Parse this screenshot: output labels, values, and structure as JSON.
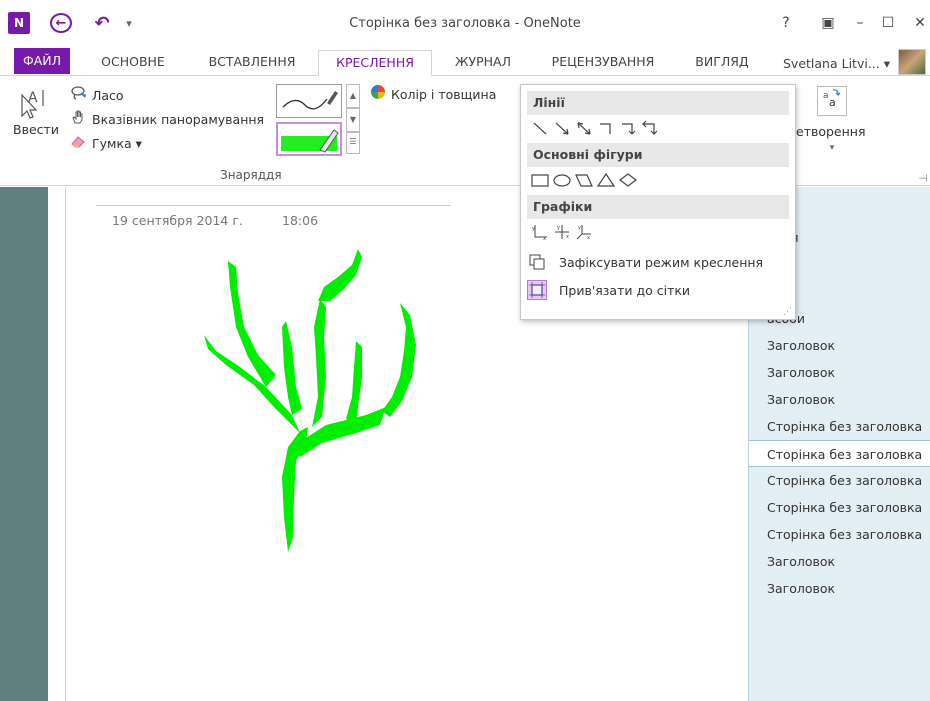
{
  "app": {
    "title": "Сторінка без заголовка - OneNote",
    "logo_text": "N",
    "back_glyph": "←",
    "undo_glyph": "↶",
    "qat_more_glyph": "▾"
  },
  "window_controls": {
    "help": "?",
    "ribbon_options": "▣",
    "minimize": "–",
    "maximize": "☐",
    "close": "✕"
  },
  "tabs": [
    {
      "label": "ФАЙЛ"
    },
    {
      "label": "ОСНОВНЕ"
    },
    {
      "label": "ВСТАВЛЕННЯ"
    },
    {
      "label": "КРЕСЛЕННЯ",
      "active": true
    },
    {
      "label": "ЖУРНАЛ"
    },
    {
      "label": "РЕЦЕНЗУВАННЯ"
    },
    {
      "label": "ВИГЛЯД"
    }
  ],
  "user": {
    "name": "Svetlana Litvi... ▾"
  },
  "ribbon": {
    "insert_label": "Ввести",
    "lasso_label": "Ласо",
    "pan_label": "Вказівник панорамування",
    "eraser_label": "Гумка ▾",
    "color_thickness_label": "Колір і товщина",
    "tools_group_label": "Знаряддя",
    "convert_label": "етворення",
    "convert_dropdown": "▾",
    "accent_color": "#7719aa",
    "pen_color": "#22ee22"
  },
  "page": {
    "date": "19 сентября 2014 г.",
    "time": "18:06",
    "ink_color": "#00ee00"
  },
  "shapes_menu": {
    "lines_header": "Лінії",
    "basic_shapes_header": "Основні фігури",
    "graphs_header": "Графіки",
    "lock_drawing_mode": "Зафіксувати режим креслення",
    "snap_to_grid": "Прив'язати до сітки"
  },
  "page_list": [
    {
      "title": "а"
    },
    {
      "title": "ання"
    },
    {
      "title": "ми"
    },
    {
      "title": "оди"
    },
    {
      "title": "асоби"
    },
    {
      "title": "Заголовок"
    },
    {
      "title": "Заголовок"
    },
    {
      "title": "Заголовок"
    },
    {
      "title": "Сторінка без заголовка"
    },
    {
      "title": "Сторінка без заголовка",
      "selected": true
    },
    {
      "title": "Сторінка без заголовка"
    },
    {
      "title": "Сторінка без заголовка"
    },
    {
      "title": "Сторінка без заголовка"
    },
    {
      "title": "Заголовок"
    },
    {
      "title": "Заголовок"
    }
  ]
}
